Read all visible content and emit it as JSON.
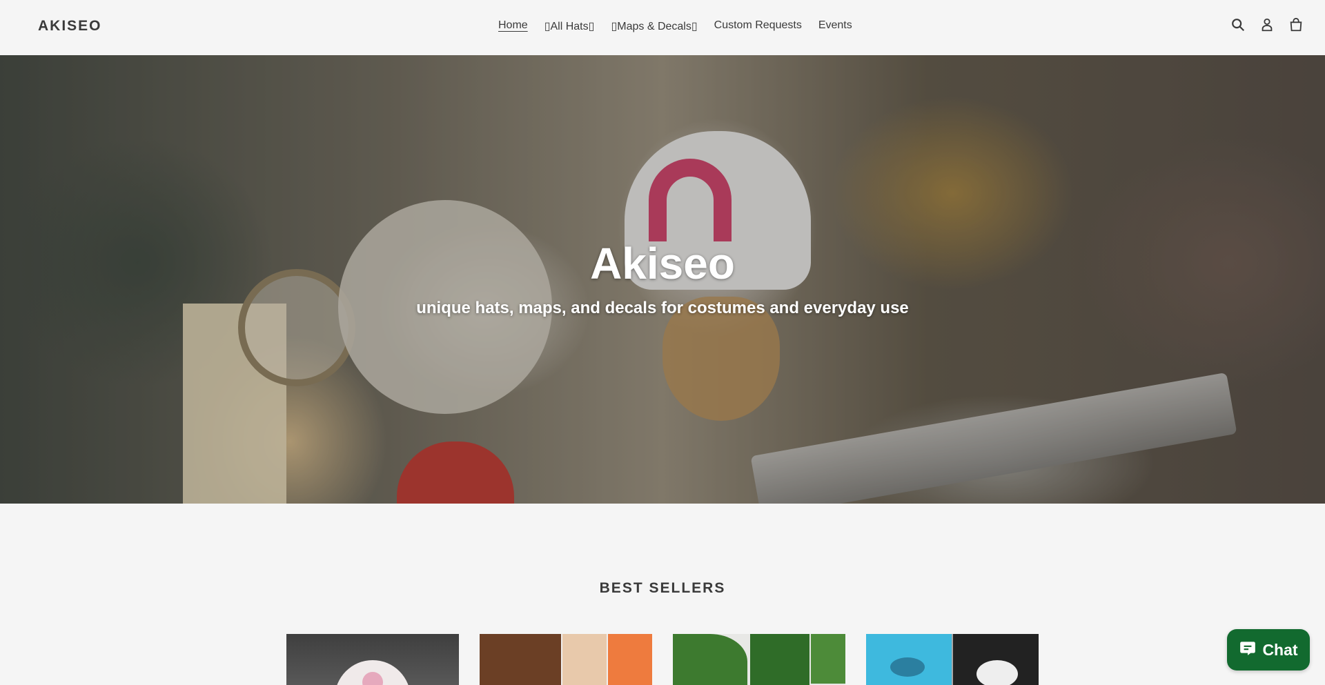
{
  "header": {
    "logo": "AKISEO",
    "nav": [
      {
        "label": "Home",
        "active": true
      },
      {
        "label": "All Hats",
        "dropdown": true
      },
      {
        "label": "Maps & Decals",
        "dropdown": true
      },
      {
        "label": "Custom Requests"
      },
      {
        "label": "Events"
      }
    ],
    "icons": [
      "search-icon",
      "account-icon",
      "cart-icon"
    ]
  },
  "hero": {
    "title": "Akiseo",
    "subtitle": "unique hats, maps, and decals for costumes and everyday use"
  },
  "best_sellers": {
    "title": "BEST SELLERS",
    "products": [
      "product-1",
      "product-2",
      "product-3",
      "product-4"
    ]
  },
  "chat": {
    "label": "Chat",
    "color": "#126a2f"
  }
}
